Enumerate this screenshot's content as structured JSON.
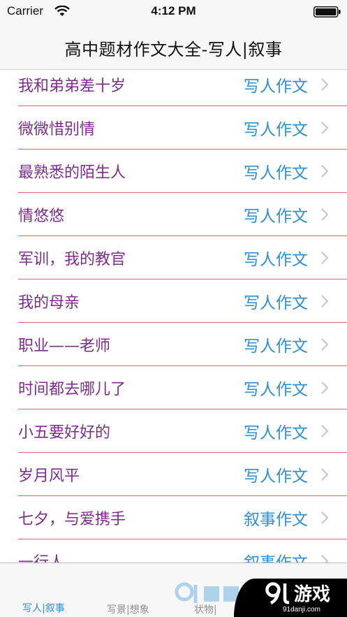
{
  "status_bar": {
    "carrier": "Carrier",
    "time": "4:12 PM",
    "wifi_icon": "wifi-icon",
    "battery_icon": "battery-icon"
  },
  "nav": {
    "title": "高中题材作文大全-写人|叙事"
  },
  "list": {
    "items": [
      {
        "title": "我和弟弟差十岁",
        "category": "写人作文"
      },
      {
        "title": "微微惜别情",
        "category": "写人作文"
      },
      {
        "title": "最熟悉的陌生人",
        "category": "写人作文"
      },
      {
        "title": "情悠悠",
        "category": "写人作文"
      },
      {
        "title": "军训，我的教官",
        "category": "写人作文"
      },
      {
        "title": "我的母亲",
        "category": "写人作文"
      },
      {
        "title": "职业——老师",
        "category": "写人作文"
      },
      {
        "title": "时间都去哪儿了",
        "category": "写人作文"
      },
      {
        "title": "小五要好好的",
        "category": "写人作文"
      },
      {
        "title": "岁月风平",
        "category": "写人作文"
      },
      {
        "title": "七夕，与爱携手",
        "category": "叙事作文"
      },
      {
        "title": "一行人",
        "category": "叙事作文"
      }
    ],
    "chevron_icon": "chevron-right-icon"
  },
  "tab_bar": {
    "tabs": [
      {
        "label": "写人|叙事",
        "active": true
      },
      {
        "label": "写景|想象",
        "active": false
      },
      {
        "label": "状物|",
        "active": false
      }
    ]
  },
  "watermark": {
    "logo": "91游戏",
    "site": "91danji.com"
  },
  "colors": {
    "title_text": "#7d2c8c",
    "category_text": "#2d8fd6",
    "divider": "#e0646e",
    "active_tab": "#2d8fd6",
    "inactive_tab": "#8e8e8e",
    "bar_background": "#f7f7f7"
  }
}
